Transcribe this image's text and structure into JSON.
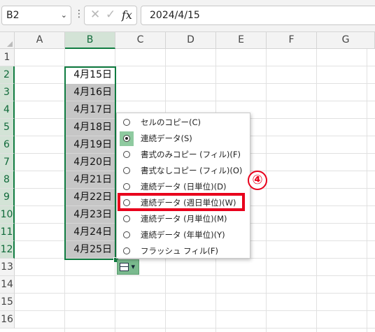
{
  "formula_bar": {
    "name_box": "B2",
    "name_box_caret": "⌄",
    "more_icon": "⋮",
    "cancel_icon": "✕",
    "enter_icon": "✓",
    "fx_label": "fx",
    "value": "2024/4/15"
  },
  "columns": [
    "A",
    "B",
    "C",
    "D",
    "E",
    "F",
    "G"
  ],
  "rows": [
    "1",
    "2",
    "3",
    "4",
    "5",
    "6",
    "7",
    "8",
    "9",
    "10",
    "11",
    "12",
    "13",
    "14",
    "15",
    "16"
  ],
  "cells_b": [
    "4月15日",
    "4月16日",
    "4月17日",
    "4月18日",
    "4月19日",
    "4月20日",
    "4月21日",
    "4月22日",
    "4月23日",
    "4月24日",
    "4月25日"
  ],
  "autofill_options_button": {
    "caret": "▾"
  },
  "autofill_menu": {
    "items": [
      "セルのコピー(C)",
      "連続データ(S)",
      "書式のみコピー (フィル)(F)",
      "書式なしコピー (フィル)(O)",
      "連続データ (日単位)(D)",
      "連続データ (週日単位)(W)",
      "連続データ (月単位)(M)",
      "連続データ (年単位)(Y)",
      "フラッシュ フィル(F)"
    ],
    "selected_index": 1,
    "highlighted_index": 5
  },
  "callout": "④",
  "colors": {
    "accent": "#107c41",
    "highlight": "#e8001c"
  }
}
